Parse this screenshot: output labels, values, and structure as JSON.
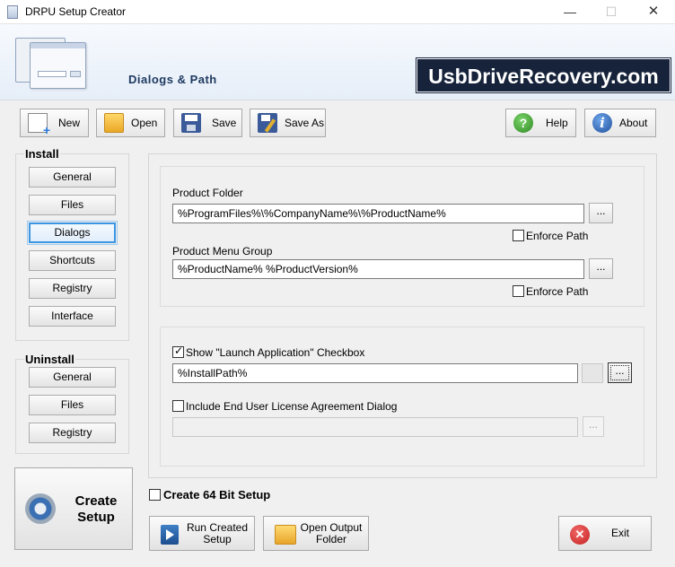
{
  "window": {
    "title": "DRPU Setup Creator",
    "min": "—",
    "max": "☐",
    "close": "✕"
  },
  "banner": {
    "section_title": "Dialogs & Path",
    "brand": "UsbDriveRecovery.com"
  },
  "toolbar": {
    "new": "New",
    "open": "Open",
    "save": "Save",
    "save_as": "Save As",
    "help": "Help",
    "about": "About",
    "help_glyph": "?",
    "about_glyph": "i"
  },
  "sidebar": {
    "install_label": "Install",
    "install_items": [
      "General",
      "Files",
      "Dialogs",
      "Shortcuts",
      "Registry",
      "Interface"
    ],
    "active_item": "Dialogs",
    "uninstall_label": "Uninstall",
    "uninstall_items": [
      "General",
      "Files",
      "Registry"
    ],
    "create_setup_line1": "Create",
    "create_setup_line2": "Setup"
  },
  "paths": {
    "product_folder_label": "Product Folder",
    "product_folder_value": "%ProgramFiles%\\%CompanyName%\\%ProductName%",
    "enforce_path_1": "Enforce Path",
    "enforce_path_1_checked": false,
    "product_menu_group_label": "Product Menu Group",
    "product_menu_group_value": "%ProductName% %ProductVersion%",
    "enforce_path_2": "Enforce Path",
    "enforce_path_2_checked": false,
    "browse": "..."
  },
  "dialogs": {
    "launch_app_label": "Show \"Launch Application\" Checkbox",
    "launch_app_checked": true,
    "launch_app_value": "%InstallPath%",
    "eula_label": "Include End User License Agreement Dialog",
    "eula_checked": false,
    "eula_value": "",
    "browse": "..."
  },
  "bottom": {
    "create_64_label": "Create 64 Bit Setup",
    "create_64_checked": false,
    "run_created_line1": "Run Created",
    "run_created_line2": "Setup",
    "open_output_line1": "Open Output",
    "open_output_line2": "Folder",
    "exit": "Exit",
    "exit_glyph": "✕"
  }
}
